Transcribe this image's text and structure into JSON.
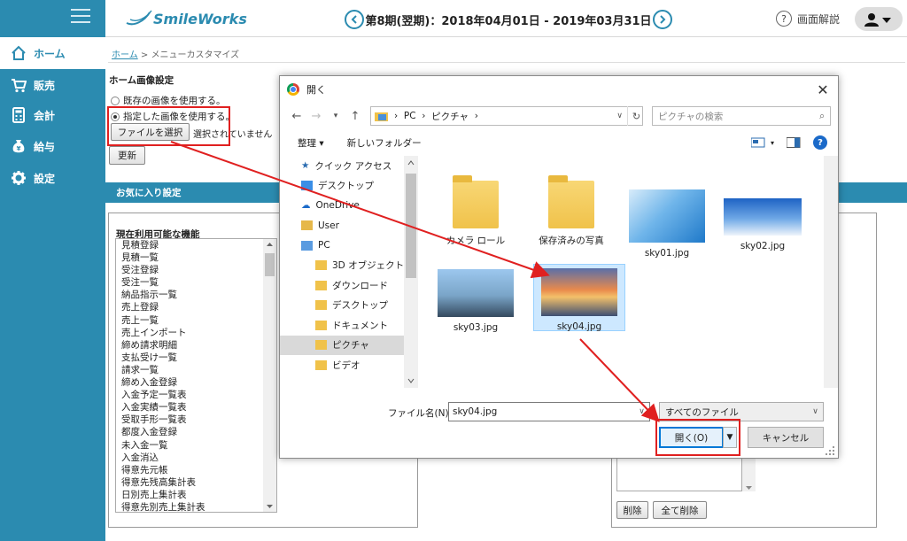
{
  "app": {
    "logo_text": "SmileWorks"
  },
  "sidebar": {
    "items": [
      {
        "label": "ホーム",
        "icon": "home-icon",
        "active": true
      },
      {
        "label": "販売",
        "icon": "cart-icon",
        "active": false
      },
      {
        "label": "会計",
        "icon": "calculator-icon",
        "active": false
      },
      {
        "label": "給与",
        "icon": "yen-bag-icon",
        "active": false
      },
      {
        "label": "設定",
        "icon": "gear-icon",
        "active": false
      }
    ]
  },
  "header": {
    "period": "第8期(翌期)：2018年04月01日 - 2019年03月31日",
    "help_label": "画面解説"
  },
  "breadcrumb": {
    "home": "ホーム",
    "current": "メニューカスタマイズ"
  },
  "home_image": {
    "section_label": "ホーム画像設定",
    "option_existing": "既存の画像を使用する。",
    "option_specified": "指定した画像を使用する。",
    "file_button": "ファイルを選択",
    "no_file_text": "選択されていません",
    "update_button": "更新"
  },
  "favorites": {
    "bar_label": "お気に入り設定",
    "available_label": "現在利用可能な機能",
    "available_items": [
      "見積登録",
      "見積一覧",
      "受注登録",
      "受注一覧",
      "納品指示一覧",
      "売上登録",
      "売上一覧",
      "売上インポート",
      "締め請求明細",
      "支払受け一覧",
      "請求一覧",
      "締め入金登録",
      "入金予定一覧表",
      "入金実績一覧表",
      "受取手形一覧表",
      "都度入金登録",
      "未入金一覧",
      "入金消込",
      "得意先元帳",
      "得意先残高集計表",
      "日別売上集計表",
      "得意先別売上集計表"
    ],
    "delete_button": "削除",
    "delete_all_button": "全て削除"
  },
  "dialog": {
    "title": "開く",
    "path": [
      "PC",
      "ピクチャ"
    ],
    "search_placeholder": "ピクチャの検索",
    "organize_label": "整理 ▾",
    "new_folder_label": "新しいフォルダー",
    "nav_items": [
      {
        "label": "クイック アクセス",
        "icon": "star-icon",
        "indent": 0,
        "selected": false
      },
      {
        "label": "デスクトップ",
        "icon": "desktop-icon",
        "indent": 0,
        "selected": false
      },
      {
        "label": "OneDrive",
        "icon": "cloud-icon",
        "indent": 0,
        "selected": false
      },
      {
        "label": "User",
        "icon": "user-icon",
        "indent": 0,
        "selected": false
      },
      {
        "label": "PC",
        "icon": "pc-icon",
        "indent": 0,
        "selected": false
      },
      {
        "label": "3D オブジェクト",
        "icon": "folder-3d-icon",
        "indent": 1,
        "selected": false
      },
      {
        "label": "ダウンロード",
        "icon": "download-folder-icon",
        "indent": 1,
        "selected": false
      },
      {
        "label": "デスクトップ",
        "icon": "desktop-folder-icon",
        "indent": 1,
        "selected": false
      },
      {
        "label": "ドキュメント",
        "icon": "documents-folder-icon",
        "indent": 1,
        "selected": false
      },
      {
        "label": "ピクチャ",
        "icon": "pictures-folder-icon",
        "indent": 1,
        "selected": true
      },
      {
        "label": "ビデオ",
        "icon": "video-folder-icon",
        "indent": 1,
        "selected": false
      }
    ],
    "files": [
      {
        "name": "カメラ ロール",
        "kind": "folder",
        "selected": false
      },
      {
        "name": "保存済みの写真",
        "kind": "folder",
        "selected": false
      },
      {
        "name": "sky01.jpg",
        "kind": "image",
        "selected": false
      },
      {
        "name": "sky02.jpg",
        "kind": "image",
        "selected": false
      },
      {
        "name": "sky03.jpg",
        "kind": "image",
        "selected": false
      },
      {
        "name": "sky04.jpg",
        "kind": "image",
        "selected": true
      }
    ],
    "filename_label": "ファイル名(N):",
    "filename_value": "sky04.jpg",
    "filetype_value": "すべてのファイル",
    "open_button": "開く(O)",
    "cancel_button": "キャンセル"
  },
  "colors": {
    "accent": "#2b8bb0",
    "annotation_red": "#e02020",
    "selection": "#cde8ff"
  }
}
